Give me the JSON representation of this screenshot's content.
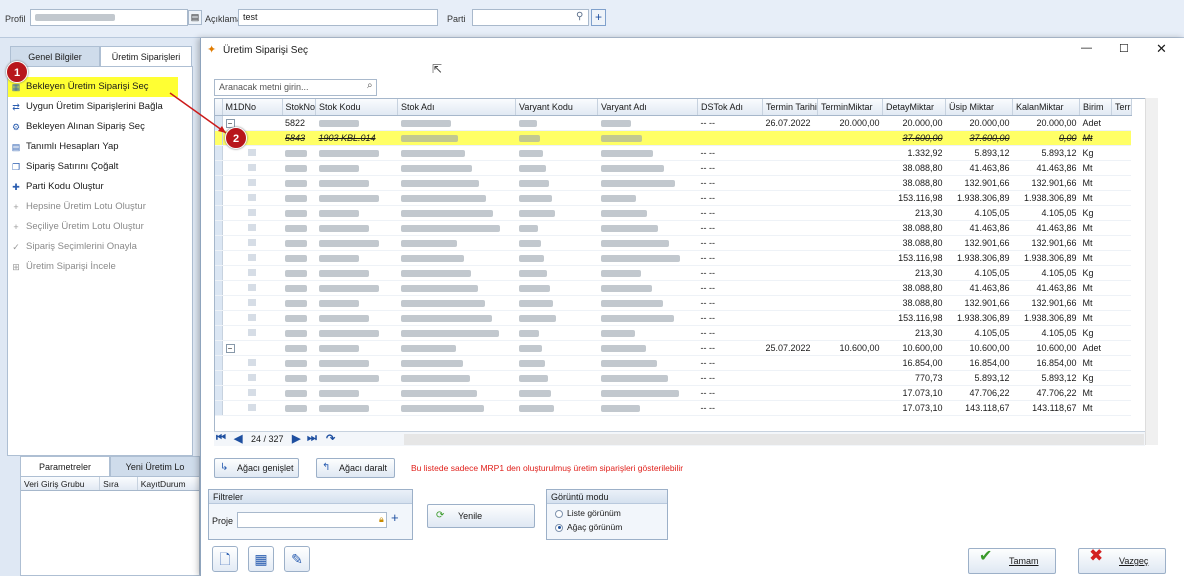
{
  "header": {
    "profil_label": "Profil",
    "aciklama_label": "Açıklama",
    "aciklama_value": "test",
    "parti_label": "Parti"
  },
  "left": {
    "tabs": [
      "Genel Bilgiler",
      "Üretim Siparişleri"
    ],
    "menu": [
      {
        "label": "Bekleyen Üretim Siparişi Seç",
        "icon": "order-select-icon",
        "enabled": true,
        "highlighted": true
      },
      {
        "label": "Uygun Üretim Siparişlerini Bağla",
        "icon": "link-orders-icon",
        "enabled": true
      },
      {
        "label": "Bekleyen Alınan Sipariş Seç",
        "icon": "received-order-icon",
        "enabled": true
      },
      {
        "label": "Tanımlı Hesapları Yap",
        "icon": "calculator-icon",
        "enabled": true
      },
      {
        "label": "Sipariş Satırını Çoğalt",
        "icon": "copy-icon",
        "enabled": true
      },
      {
        "label": "Parti Kodu Oluştur",
        "icon": "batch-code-icon",
        "enabled": true
      },
      {
        "label": "Hepsine Üretim Lotu Oluştur",
        "icon": "plus-icon",
        "enabled": false
      },
      {
        "label": "Seçiliye Üretim Lotu Oluştur",
        "icon": "plus-icon",
        "enabled": false
      },
      {
        "label": "Sipariş Seçimlerini Onayla",
        "icon": "check-icon",
        "enabled": false
      },
      {
        "label": "Üretim Siparişi İncele",
        "icon": "inspect-icon",
        "enabled": false
      }
    ],
    "bottom_tabs": [
      "Parametreler",
      "Yeni Üretim Lo"
    ],
    "bottom_columns": [
      "Veri Giriş Grubu",
      "Sıra",
      "KayıtDurum"
    ],
    "badge1": "1",
    "badge2": "2"
  },
  "dialog": {
    "title": "Üretim Siparişi Seç",
    "search_placeholder": "Aranacak metni girin...",
    "columns": [
      "M1DNo",
      "StokNo",
      "Stok Kodu",
      "Stok Adı",
      "Varyant Kodu",
      "Varyant Adı",
      "DSTok Adı",
      "Termin Tarihi",
      "TerminMiktar",
      "DetayMiktar",
      "Üsip Miktar",
      "KalanMiktar",
      "Birim",
      "Terr"
    ],
    "rows": [
      {
        "type": "parent",
        "stokno": "5822",
        "dstok": "-- --",
        "termin": "26.07.2022",
        "terminmiktar": "20.000,00",
        "detay": "20.000,00",
        "usip": "20.000,00",
        "kalan": "20.000,00",
        "birim": "Adet"
      },
      {
        "type": "hl",
        "stokno": "5843",
        "stokkodu": "1903 KBL.014",
        "dstok": "",
        "termin": "",
        "terminmiktar": "",
        "detay": "37.600,00",
        "usip": "37.600,00",
        "kalan": "0,00",
        "birim": "Mt"
      },
      {
        "type": "child",
        "dstok": "-- --",
        "detay": "1.332,92",
        "usip": "5.893,12",
        "kalan": "5.893,12",
        "birim": "Kg"
      },
      {
        "type": "child",
        "dstok": "-- --",
        "detay": "38.088,80",
        "usip": "41.463,86",
        "kalan": "41.463,86",
        "birim": "Mt"
      },
      {
        "type": "child",
        "dstok": "-- --",
        "detay": "38.088,80",
        "usip": "132.901,66",
        "kalan": "132.901,66",
        "birim": "Mt"
      },
      {
        "type": "child",
        "dstok": "-- --",
        "detay": "153.116,98",
        "usip": "1.938.306,89",
        "kalan": "1.938.306,89",
        "birim": "Mt"
      },
      {
        "type": "child",
        "dstok": "-- --",
        "detay": "213,30",
        "usip": "4.105,05",
        "kalan": "4.105,05",
        "birim": "Kg"
      },
      {
        "type": "child",
        "dstok": "-- --",
        "detay": "38.088,80",
        "usip": "41.463,86",
        "kalan": "41.463,86",
        "birim": "Mt"
      },
      {
        "type": "child",
        "dstok": "-- --",
        "detay": "38.088,80",
        "usip": "132.901,66",
        "kalan": "132.901,66",
        "birim": "Mt"
      },
      {
        "type": "child",
        "dstok": "-- --",
        "detay": "153.116,98",
        "usip": "1.938.306,89",
        "kalan": "1.938.306,89",
        "birim": "Mt"
      },
      {
        "type": "child",
        "dstok": "-- --",
        "detay": "213,30",
        "usip": "4.105,05",
        "kalan": "4.105,05",
        "birim": "Kg"
      },
      {
        "type": "child",
        "dstok": "-- --",
        "detay": "38.088,80",
        "usip": "41.463,86",
        "kalan": "41.463,86",
        "birim": "Mt"
      },
      {
        "type": "child",
        "dstok": "-- --",
        "detay": "38.088,80",
        "usip": "132.901,66",
        "kalan": "132.901,66",
        "birim": "Mt"
      },
      {
        "type": "child",
        "dstok": "-- --",
        "detay": "153.116,98",
        "usip": "1.938.306,89",
        "kalan": "1.938.306,89",
        "birim": "Mt"
      },
      {
        "type": "child",
        "dstok": "-- --",
        "detay": "213,30",
        "usip": "4.105,05",
        "kalan": "4.105,05",
        "birim": "Kg"
      },
      {
        "type": "parent",
        "dstok": "-- --",
        "termin": "25.07.2022",
        "terminmiktar": "10.600,00",
        "detay": "10.600,00",
        "usip": "10.600,00",
        "kalan": "10.600,00",
        "birim": "Adet"
      },
      {
        "type": "child",
        "dstok": "-- --",
        "detay": "16.854,00",
        "usip": "16.854,00",
        "kalan": "16.854,00",
        "birim": "Mt"
      },
      {
        "type": "child",
        "dstok": "-- --",
        "detay": "770,73",
        "usip": "5.893,12",
        "kalan": "5.893,12",
        "birim": "Kg"
      },
      {
        "type": "child",
        "dstok": "-- --",
        "detay": "17.073,10",
        "usip": "47.706,22",
        "kalan": "47.706,22",
        "birim": "Mt"
      },
      {
        "type": "child",
        "dstok": "-- --",
        "detay": "17.073,10",
        "usip": "143.118,67",
        "kalan": "143.118,67",
        "birim": "Mt"
      }
    ],
    "pager": "24 / 327",
    "expand_label": "Ağacı genişlet",
    "collapse_label": "Ağacı daralt",
    "info_text": "Bu listede sadece MRP1 den oluşturulmuş üretim siparişleri gösterilebilir",
    "filters_title": "Filtreler",
    "proje_label": "Proje",
    "refresh_label": "Yenile",
    "view_mode_title": "Görüntü modu",
    "view_list": "Liste görünüm",
    "view_tree": "Ağaç görünüm",
    "ok_label": "Tamam",
    "cancel_label": "Vazgeç"
  },
  "colors": {
    "highlight": "#ffff66",
    "info": "#e0201b",
    "accent": "#1e4fa0"
  }
}
